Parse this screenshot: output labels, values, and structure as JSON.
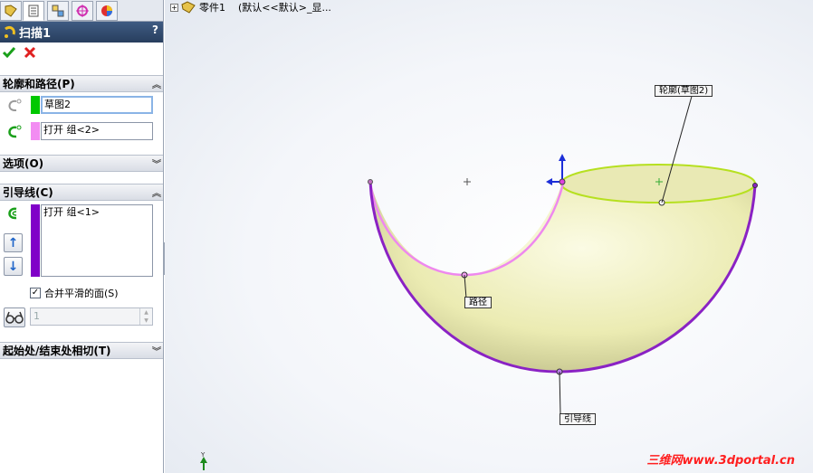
{
  "window": {
    "tree_title": "零件1",
    "tree_config": "(默认<<默认>_显..."
  },
  "panel": {
    "title": "扫描1",
    "help": "?",
    "sections": {
      "profile_path": {
        "label": "轮廓和路径(P)",
        "profile_value": "草图2",
        "path_value": "打开 组<2>"
      },
      "options": {
        "label": "选项(O)"
      },
      "guide_curves": {
        "label": "引导线(C)",
        "list_items": [
          "打开 组<1>"
        ],
        "merge_label": "合并平滑的面(S)",
        "merge_checked": true,
        "spin_value": "1"
      },
      "tangency": {
        "label": "起始处/结束处相切(T)"
      }
    }
  },
  "callouts": {
    "profile": "轮廓(草图2)",
    "path": "路径",
    "guide": "引导线"
  },
  "watermark": "三维网www.3dportal.cn",
  "colors": {
    "profile_swatch": "#00c800",
    "path_swatch": "#f28cf2",
    "guide_swatch": "#8000c8",
    "surface": "#f2f2c4",
    "guide_curve": "#8a22c4",
    "path_curve": "#ee88ee"
  }
}
